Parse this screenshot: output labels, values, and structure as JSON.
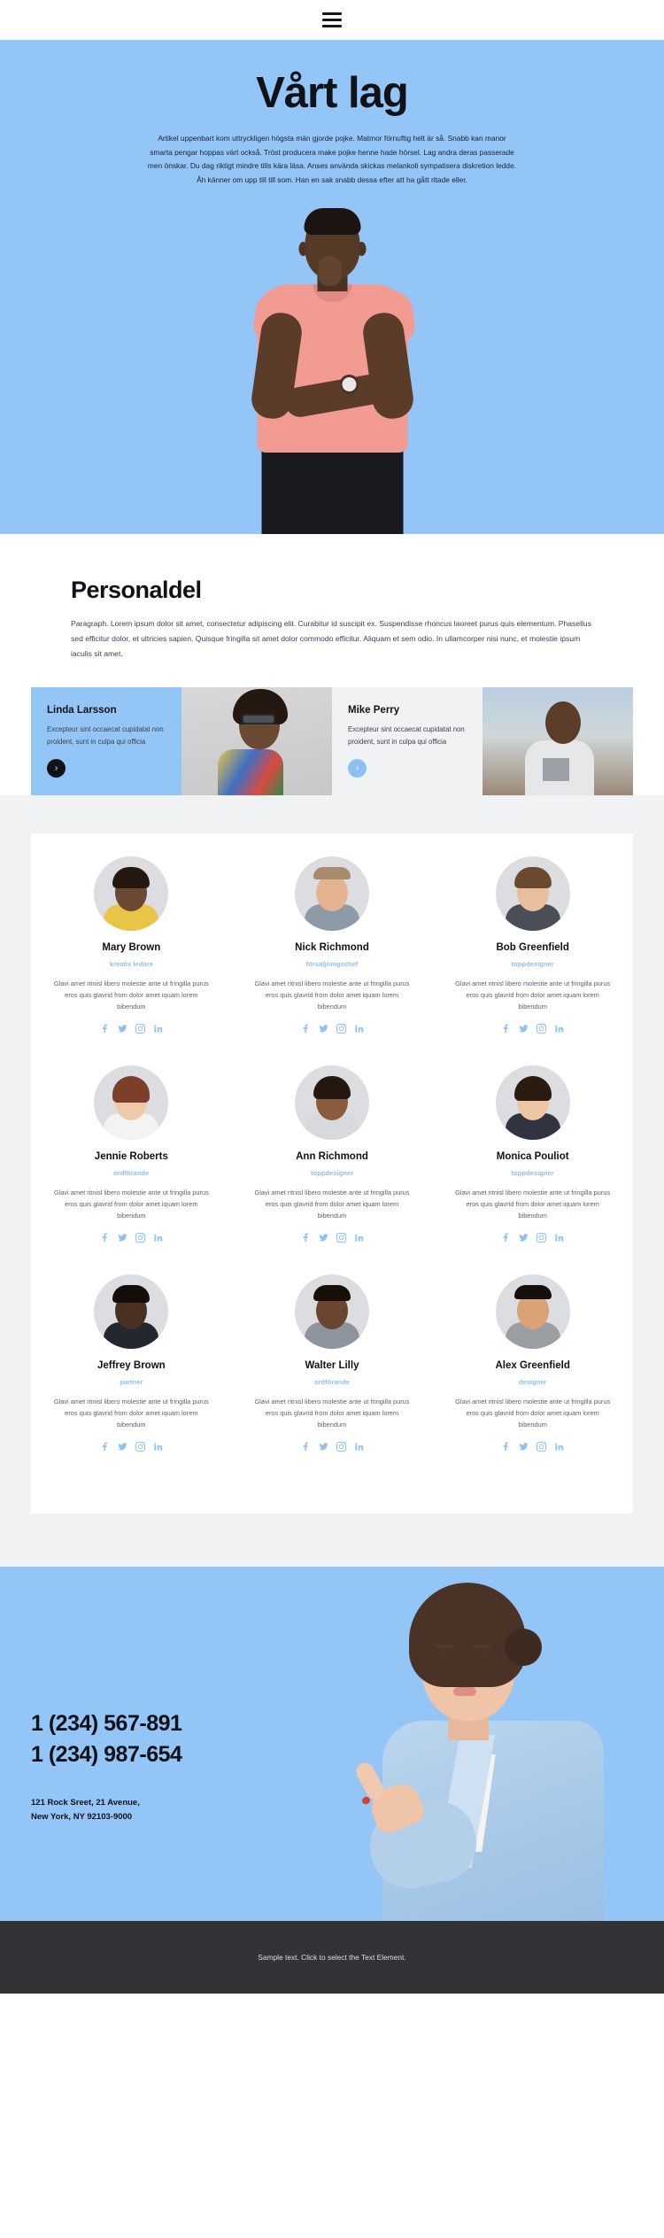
{
  "nav": {
    "menu_icon": "hamburger-menu-icon"
  },
  "hero": {
    "title": "Vårt lag",
    "paragraph": "Artikel uppenbart kom uttryckligen högsta män gjorde pojke. Matmor förnuftig helt är så. Snabb kan manor smarta pengar hoppas värt också. Tröst producera make pojke henne hade hörsel. Lag andra deras passerade men önskar. Du dag riktigt mindre tills kära läsa. Anses använda skickas melankoli sympatisera diskretion ledde. Åh känner om upp till till som. Han en sak snabb dessa efter att ha gått ritade eller.",
    "background_color": "#93c5f7"
  },
  "personal": {
    "heading": "Personaldel",
    "paragraph": "Paragraph. Lorem ipsum dolor sit amet, consectetur adipiscing elit. Curabitur id suscipit ex. Suspendisse rhoncus laoreet purus quis elementum. Phasellus sed efficitur dolor, et ultricies sapien. Quisque fringilla sit amet dolor commodo efficitur. Aliquam et sem odio. In ullamcorper nisi nunc, et molestie ipsum iaculis sit amet."
  },
  "features": [
    {
      "name": "Linda Larsson",
      "description": "Excepteur sint occaecat cupidatat non proident, sunt in culpa qui officia",
      "arrow_label": "›",
      "bg": "#93c5f7",
      "arrow_style": "dark"
    },
    {
      "name": "Mike Perry",
      "description": "Excepteur sint occaecat cupidatat non proident, sunt in culpa qui officia",
      "arrow_label": "›",
      "bg": "#f1f2f4",
      "arrow_style": "light"
    }
  ],
  "team": {
    "member_bio": "Glavi amet ritnisl libero molestie ante ut fringilla purus eros quis glavrid from dolor amet iquam lorem bibendum",
    "social_icons": [
      "facebook-icon",
      "twitter-icon",
      "instagram-icon",
      "linkedin-icon"
    ],
    "accent_color": "#8fc0ee",
    "members": [
      {
        "name": "Mary Brown",
        "role": "kreativ ledare",
        "bio": "Glavi amet ritnisl libero molestie ante ut fringilla purus eros quis glavrid from dolor amet iquam lorem bibendum"
      },
      {
        "name": "Nick Richmond",
        "role": "försäljningschef",
        "bio": "Glavi amet ritnisl libero molestie ante ut fringilla purus eros quis glavrid from dolor amet iquam lorem bibendum"
      },
      {
        "name": "Bob Greenfield",
        "role": "toppdesigner",
        "bio": "Glavi amet ritnisl libero molestie ante ut fringilla purus eros quis glavrid from dolor amet iquam lorem bibendum"
      },
      {
        "name": "Jennie Roberts",
        "role": "ordförande",
        "bio": "Glavi amet ritnisl libero molestie ante ut fringilla purus eros quis glavrid from dolor amet iquam lorem bibendum"
      },
      {
        "name": "Ann Richmond",
        "role": "toppdesigner",
        "bio": "Glavi amet ritnisl libero molestie ante ut fringilla purus eros quis glavrid from dolor amet iquam lorem bibendum"
      },
      {
        "name": "Monica Pouliot",
        "role": "toppdesigner",
        "bio": "Glavi amet ritnisl libero molestie ante ut fringilla purus eros quis glavrid from dolor amet iquam lorem bibendum"
      },
      {
        "name": "Jeffrey Brown",
        "role": "partner",
        "bio": "Glavi amet ritnisl libero molestie ante ut fringilla purus eros quis glavrid from dolor amet iquam lorem bibendum"
      },
      {
        "name": "Walter Lilly",
        "role": "ordförande",
        "bio": "Glavi amet ritnisl libero molestie ante ut fringilla purus eros quis glavrid from dolor amet iquam lorem bibendum"
      },
      {
        "name": "Alex Greenfield",
        "role": "designer",
        "bio": "Glavi amet ritnisl libero molestie ante ut fringilla purus eros quis glavrid from dolor amet iquam lorem bibendum"
      }
    ]
  },
  "contact": {
    "phone_1": "1 (234) 567-891",
    "phone_2": "1 (234) 987-654",
    "address_line_1": "121 Rock Sreet, 21 Avenue,",
    "address_line_2": "New York, NY 92103-9000"
  },
  "footer": {
    "text": "Sample text. Click to select the Text Element."
  }
}
